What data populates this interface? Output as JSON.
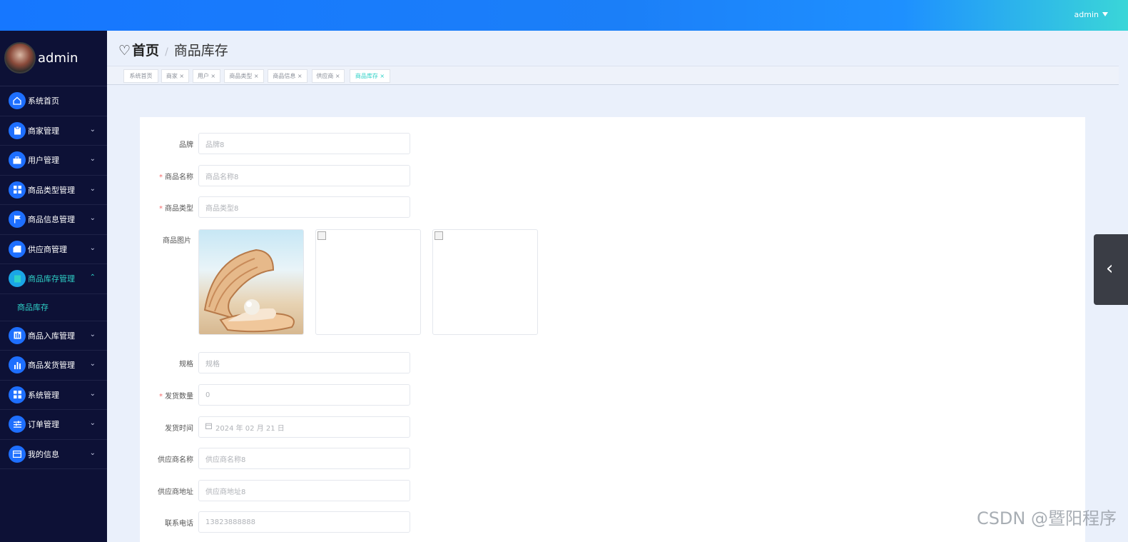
{
  "header": {
    "user": "admin"
  },
  "sidebar": {
    "profile_name": "admin",
    "items": [
      {
        "label": "系统首页",
        "icon": "home-icon"
      },
      {
        "label": "商家管理",
        "icon": "clipboard-icon"
      },
      {
        "label": "用户管理",
        "icon": "briefcase-icon"
      },
      {
        "label": "商品类型管理",
        "icon": "grid-icon"
      },
      {
        "label": "商品信息管理",
        "icon": "flag-icon"
      },
      {
        "label": "供应商管理",
        "icon": "shop-icon"
      },
      {
        "label": "商品库存管理",
        "icon": "clipboard-icon"
      },
      {
        "label": "商品入库管理",
        "icon": "bars-icon"
      },
      {
        "label": "商品发货管理",
        "icon": "chart-icon"
      },
      {
        "label": "系统管理",
        "icon": "grid-icon"
      },
      {
        "label": "订单管理",
        "icon": "sliders-icon"
      },
      {
        "label": "我的信息",
        "icon": "card-icon"
      }
    ],
    "submenu": "商品库存"
  },
  "breadcrumb": {
    "home": "首页",
    "separator": "/",
    "current": "商品库存"
  },
  "tabs": [
    "系统首页",
    "商家 ×",
    "用户 ×",
    "商品类型 ×",
    "商品信息 ×",
    "供应商 ×",
    "商品库存 ×"
  ],
  "form": {
    "brand": {
      "label": "品牌",
      "value": "品牌8"
    },
    "name": {
      "label": "商品名称",
      "value": "商品名称8"
    },
    "type": {
      "label": "商品类型",
      "value": "商品类型8"
    },
    "images": {
      "label": "商品图片"
    },
    "spec": {
      "label": "规格",
      "value": "规格"
    },
    "ship_qty": {
      "label": "发货数量",
      "value": "0"
    },
    "ship_time": {
      "label": "发货时间",
      "value": "2024 年 02 月 21 日"
    },
    "supplier_name": {
      "label": "供应商名称",
      "value": "供应商名称8"
    },
    "supplier_addr": {
      "label": "供应商地址",
      "value": "供应商地址8"
    },
    "phone": {
      "label": "联系电话",
      "value": "13823888888"
    },
    "required_mark": "*"
  },
  "watermark": "CSDN @暨阳程序",
  "colors": {
    "accent": "#1e6fff",
    "active": "#2ed1c7",
    "sidebar_bg": "#0d1136",
    "required": "#f56c6c"
  }
}
